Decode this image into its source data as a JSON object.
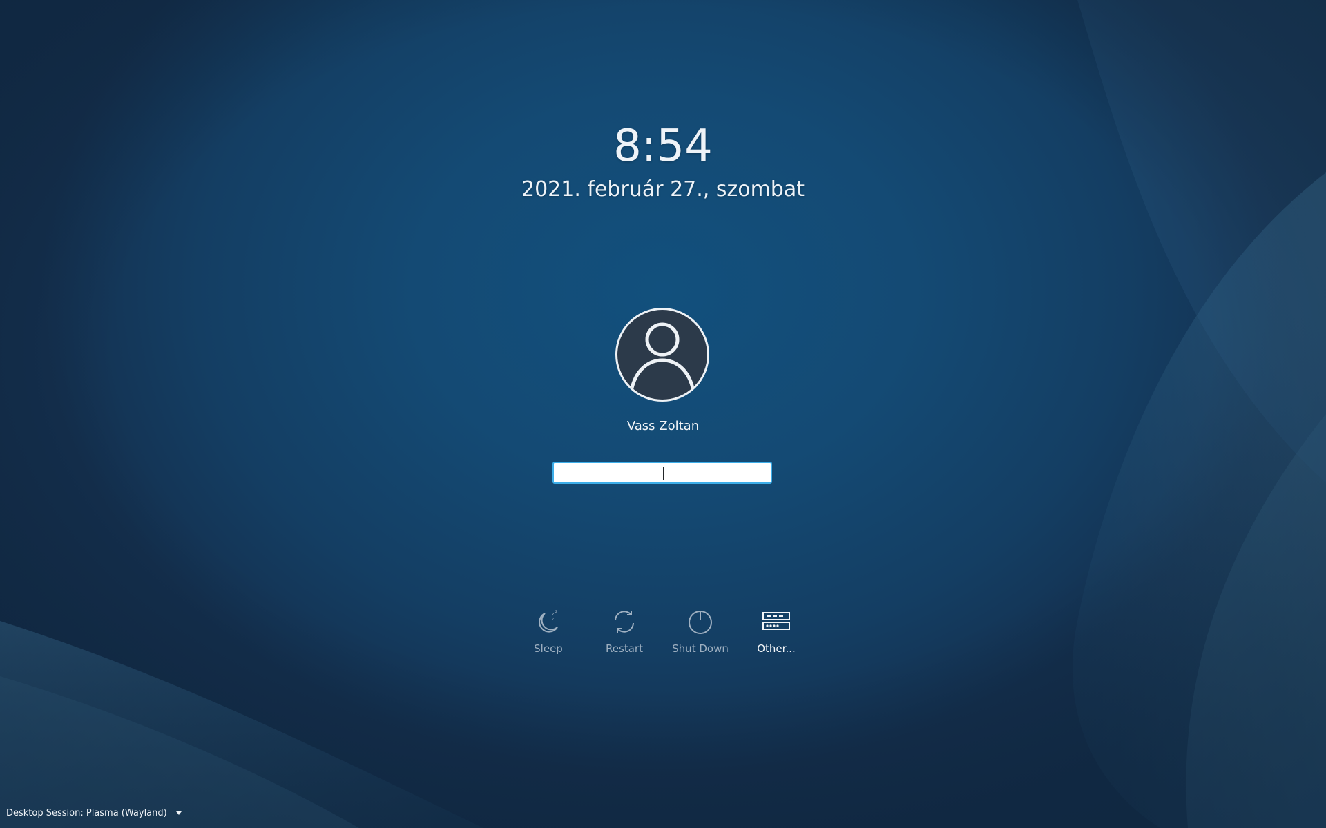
{
  "clock": {
    "time": "8:54",
    "date": "2021. február 27., szombat"
  },
  "user": {
    "name": "Vass Zoltan",
    "avatar_icon": "user-avatar-icon"
  },
  "password_field": {
    "value": "",
    "placeholder": ""
  },
  "actions": [
    {
      "label": "Sleep",
      "icon": "sleep-icon"
    },
    {
      "label": "Restart",
      "icon": "restart-icon"
    },
    {
      "label": "Shut Down",
      "icon": "shutdown-icon"
    },
    {
      "label": "Other...",
      "icon": "switch-user-icon"
    }
  ],
  "session": {
    "label": "Desktop Session: Plasma (Wayland)",
    "icon": "chevron-down-icon"
  },
  "colors": {
    "accent": "#3daee9",
    "background": "#144a74",
    "text": "#eef3f8",
    "muted_text": "#9fb0c1"
  }
}
